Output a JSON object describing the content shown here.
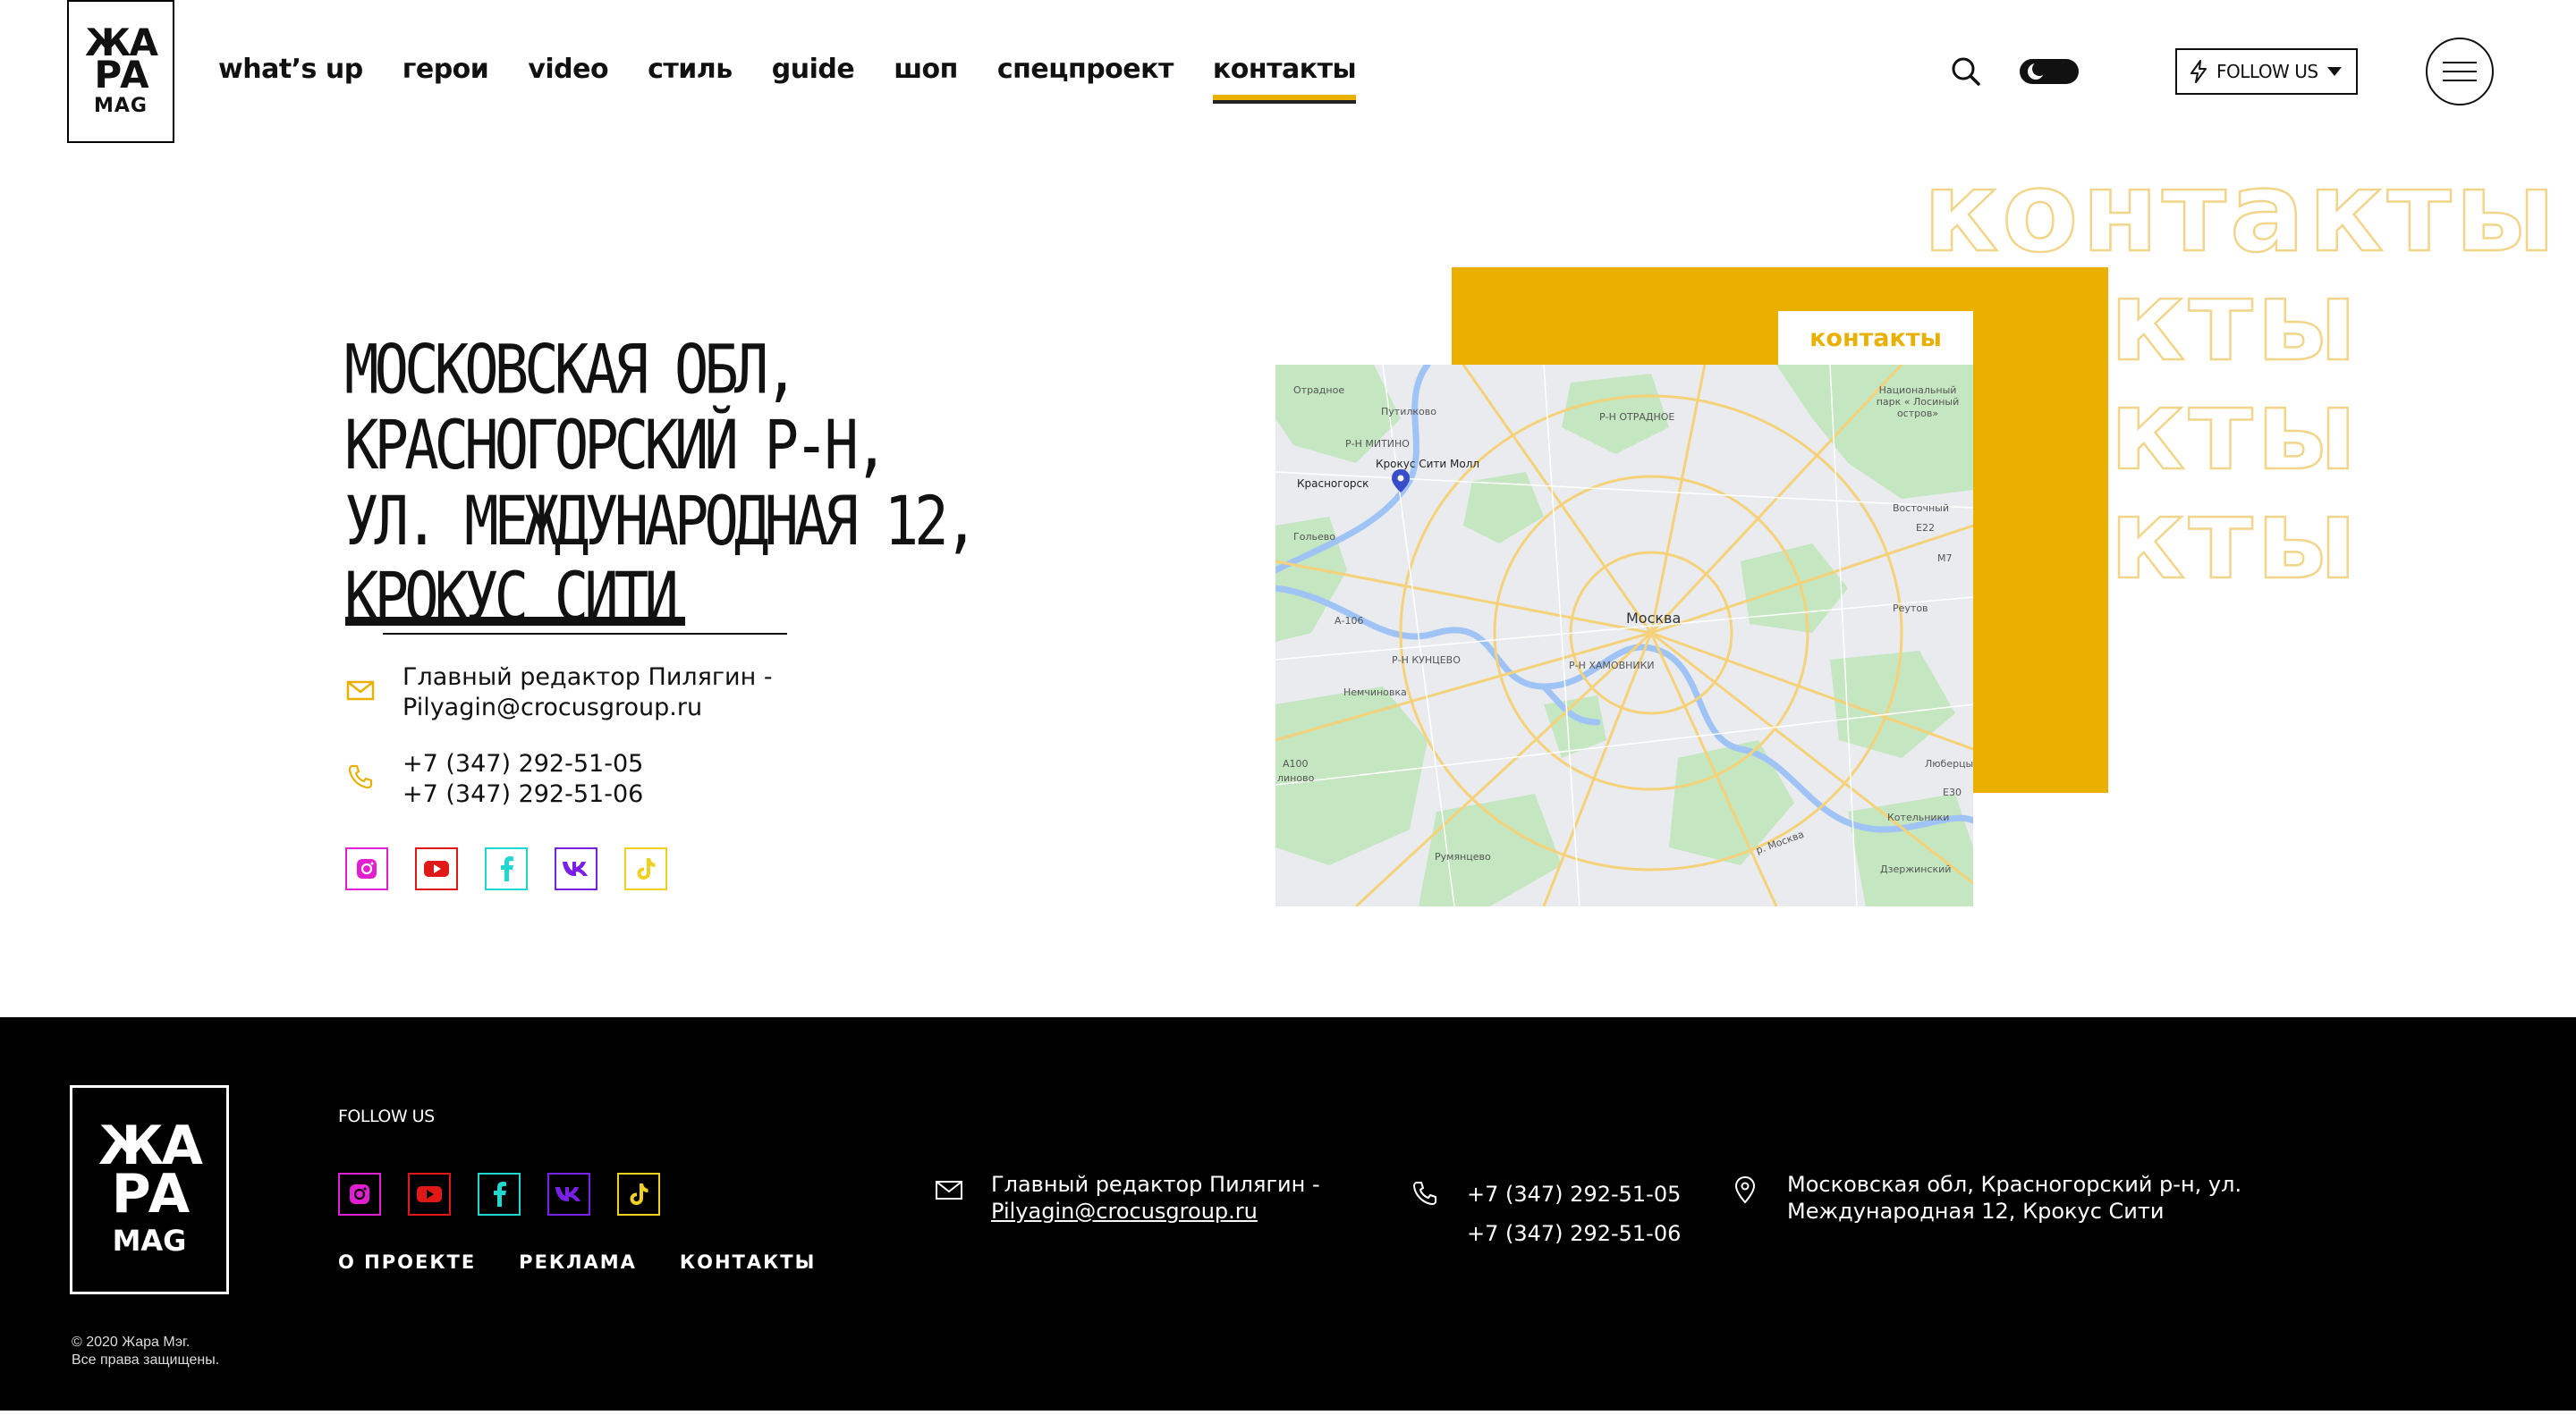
{
  "brand": {
    "logo_top": "ЖА",
    "logo_mid": "РА",
    "logo_bottom": "MAG"
  },
  "nav": {
    "items": [
      {
        "label": "what’s up"
      },
      {
        "label": "герои"
      },
      {
        "label": "video"
      },
      {
        "label": "стиль"
      },
      {
        "label": "guide"
      },
      {
        "label": "шоп"
      },
      {
        "label": "спецпроект"
      },
      {
        "label": "контакты",
        "active": true
      }
    ]
  },
  "header": {
    "follow_label": "FOLLOW US",
    "theme_toggle": "dark-mode-toggle"
  },
  "hero": {
    "bg_word": "контакты",
    "address_lines": [
      "МОСКОВСКАЯ ОБЛ,",
      "КРАСНОГОРСКИЙ Р-Н,",
      "УЛ. МЕЖДУНАРОДНАЯ 12,",
      "КРОКУС СИТИ"
    ],
    "mail_line1": "Главный редактор Пилягин -",
    "mail_line2": "Pilyagin@crocusgroup.ru",
    "phone1": "+7 (347) 292-51-05",
    "phone2": "+7 (347) 292-51-06",
    "tag_label": "контакты"
  },
  "map": {
    "labels": {
      "otradnoe": "Отрадное",
      "putilkovo": "Путилково",
      "mitino": "Р-Н МИТИНО",
      "otradnoe_dist": "Р-Н ОТРАДНОЕ",
      "krokus": "Крокус Сити Молл",
      "krasnogorsk": "Красногорск",
      "park": "Национальный парк « Лосиный остров»",
      "vostochny": "Восточный",
      "golyevo": "Гольево",
      "moskva": "Москва",
      "reutov": "Реутов",
      "kuntsevo": "Р-Н КУНЦЕВО",
      "khamovniki": "Р-Н ХАМОВНИКИ",
      "nemchinovka": "Немчиновка",
      "lyubertsy": "Люберцы",
      "kotelniki": "Котельники",
      "rumyantsevo": "Румянцево",
      "dzerzhinsky": "Дзержинский",
      "moskva_river": "р. Москва",
      "a106": "А-106",
      "a100": "А100",
      "m7": "M7",
      "e30": "E30",
      "e22": "E22",
      "ilino": "линово"
    }
  },
  "footer": {
    "logo_top": "ЖА",
    "logo_mid": "РА",
    "logo_bottom": "MAG",
    "copyright_line1": "© 2020 Жара Мэг.",
    "copyright_line2": "Все права защищены.",
    "follow_label": "FOLLOW US",
    "links": [
      "О ПРОЕКТЕ",
      "РЕКЛАМА",
      "КОНТАКТЫ"
    ],
    "mail_line1": "Главный редактор Пилягин -",
    "mail_line2": "Pilyagin@crocusgroup.ru",
    "phone1": "+7 (347) 292-51-05",
    "phone2": "+7 (347) 292-51-06",
    "address_line1": "Московская обл, Красногорский р-н, ул.",
    "address_line2": "Международная 12, Крокус Сити"
  },
  "colors": {
    "accent": "#e9b000",
    "instagram": "#e020d0",
    "youtube": "#e01818",
    "facebook": "#20d8d0",
    "vk": "#7820e8",
    "tiktok": "#f0d020"
  }
}
